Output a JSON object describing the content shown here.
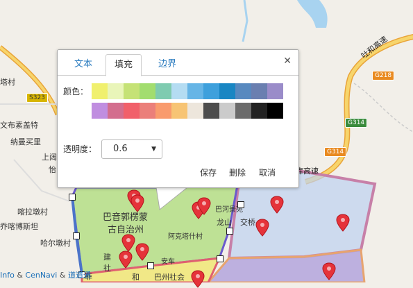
{
  "map": {
    "labels": {
      "ta_cun": "塔村",
      "wenbu_suogai": "文布素盖特",
      "nayi_maili": "纳曼买里",
      "shanggeng_tu": "上阔图",
      "kaerdun": "喀拉墩村",
      "qiaoke_bo": "乔喀博斯坦",
      "haer_dun": "哈尔墩村",
      "bayin": "巴音郭楞蒙",
      "autonomous": "古自治州",
      "akota": "阿克塔什村",
      "longshan": "龙山",
      "jiaoqiao": "交桥",
      "jian": "建",
      "she": "社",
      "yi": "怡",
      "bazhou": "巴州社会",
      "he": "和",
      "anzhe": "安车",
      "bahe": "巴河景苑",
      "tuhe_gaosu": "吐和高速",
      "kuai_gaosu": "库高速",
      "shield_s323": "S323",
      "shield_g218": "G218",
      "shield_g314a": "G314",
      "shield_g314b": "G314",
      "fei": "菲"
    },
    "attribution": {
      "info": "Info",
      "amp1": " & ",
      "cennavi": "CenNavi",
      "amp2": " & ",
      "daodaotong": "道道通"
    }
  },
  "popup": {
    "tabs": [
      "文本",
      "填充",
      "边界"
    ],
    "active_tab": "填充",
    "close_symbol": "✕",
    "color_label": "颜色：",
    "colors_row1": [
      "#f0f06e",
      "#e9f5b9",
      "#c5e276",
      "#a2dd6f",
      "#7fcbb0",
      "#b4dcf2",
      "#66b5e6",
      "#3ea0dc",
      "#1986c3",
      "#5889bf",
      "#6a7fb0",
      "#9a8cc9"
    ],
    "colors_row2": [
      "#c08ee0",
      "#d36e8e",
      "#f1606a",
      "#eb7f7a",
      "#f99b6d",
      "#f7c474",
      "#ede6dc",
      "#4d4d4d",
      "#cbcbcb",
      "#6b6b6b",
      "#222222",
      "#000000"
    ],
    "opacity_label": "透明度：",
    "opacity_value": "0.6",
    "opacity_caret": "▼",
    "actions": {
      "save": "保存",
      "delete": "删除",
      "cancel": "取消"
    }
  }
}
